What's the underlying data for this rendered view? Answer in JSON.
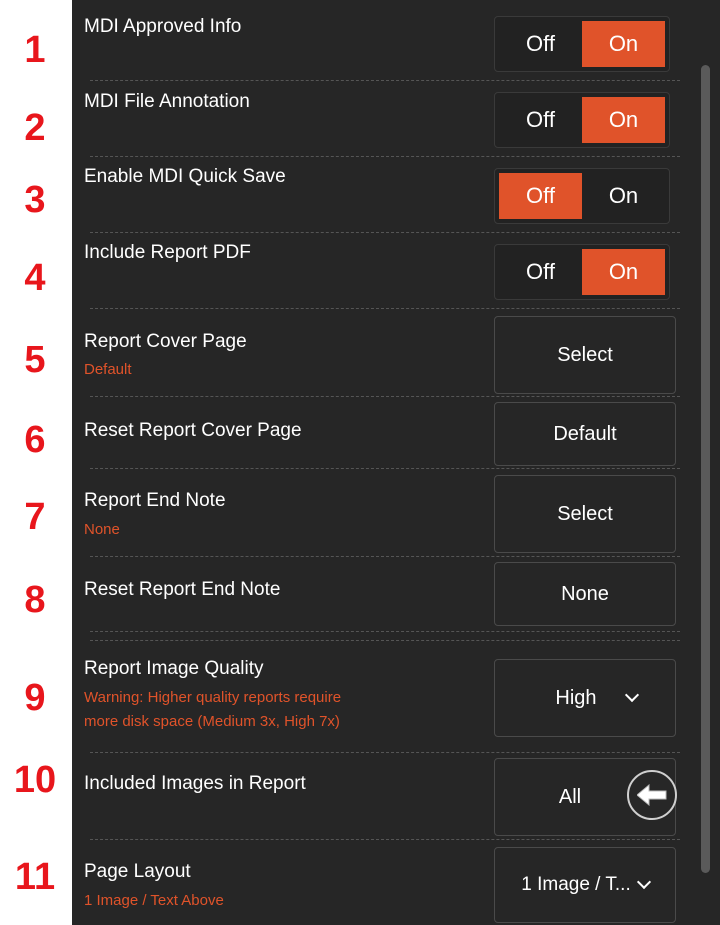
{
  "row_numbers": [
    "1",
    "2",
    "3",
    "4",
    "5",
    "6",
    "7",
    "8",
    "9",
    "10",
    "11"
  ],
  "settings": {
    "mdi_approved_info": {
      "label": "MDI Approved Info",
      "off": "Off",
      "on": "On",
      "value": "On"
    },
    "mdi_file_annotation": {
      "label": "MDI File Annotation",
      "off": "Off",
      "on": "On",
      "value": "On"
    },
    "enable_mdi_quick_save": {
      "label": "Enable MDI Quick Save",
      "off": "Off",
      "on": "On",
      "value": "Off"
    },
    "include_report_pdf": {
      "label": "Include Report PDF",
      "off": "Off",
      "on": "On",
      "value": "On"
    },
    "report_cover_page": {
      "label": "Report Cover Page",
      "sub": "Default",
      "button": "Select"
    },
    "reset_report_cover_page": {
      "label": "Reset Report Cover Page",
      "button": "Default"
    },
    "report_end_note": {
      "label": "Report End Note",
      "sub": "None",
      "button": "Select"
    },
    "reset_report_end_note": {
      "label": "Reset Report End Note",
      "button": "None"
    },
    "report_image_quality": {
      "label": "Report Image Quality",
      "sub_line1": "Warning: Higher quality reports require",
      "sub_line2": "more disk space (Medium 3x, High 7x)",
      "value": "High"
    },
    "included_images_in_report": {
      "label": "Included Images in Report",
      "value": "All"
    },
    "page_layout": {
      "label": "Page Layout",
      "sub": "1 Image / Text Above",
      "value": "1 Image / T..."
    }
  },
  "colors": {
    "accent": "#e0532a",
    "panel": "#262626",
    "number": "#e8161c"
  },
  "icons": {
    "back": "back-arrow-icon",
    "chevron": "chevron-down-icon"
  }
}
